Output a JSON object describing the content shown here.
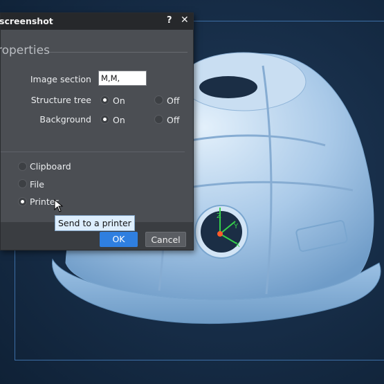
{
  "dialog": {
    "title": "screenshot",
    "help_icon": "?",
    "close_icon": "✕",
    "section_title": "roperties",
    "image_section": {
      "label": "Image section",
      "value": "M,M,"
    },
    "structure_tree": {
      "label": "Structure tree",
      "on": "On",
      "off": "Off",
      "selected": "On"
    },
    "background": {
      "label": "Background",
      "on": "On",
      "off": "Off",
      "selected": "On"
    },
    "output_options": [
      {
        "label": "Clipboard",
        "selected": false
      },
      {
        "label": "File",
        "selected": false
      },
      {
        "label": "Printer",
        "selected": true
      }
    ],
    "ok_label": "OK",
    "cancel_label": "Cancel",
    "tooltip": "Send to a printer"
  },
  "viewport": {
    "axes": {
      "z": "Z",
      "y": "Y",
      "x": "X"
    },
    "colors": {
      "accent": "#2f7fe0",
      "frame": "#3d6fa6"
    }
  }
}
